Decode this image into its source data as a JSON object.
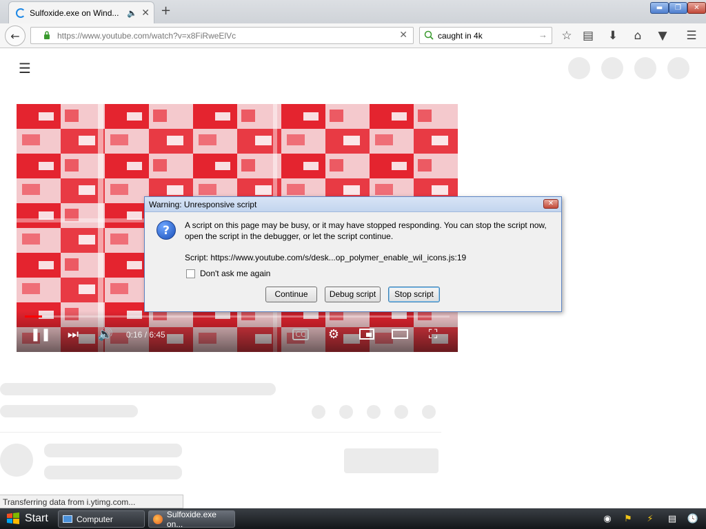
{
  "browser": {
    "tab_title": "Sulfoxide.exe on Wind...",
    "url": "https://www.youtube.com/watch?v=x8FiRweElVc",
    "search_text": "caught in 4k"
  },
  "video": {
    "time": "0:16 / 6:45",
    "progress_fraction": 0.04
  },
  "dialog": {
    "title": "Warning: Unresponsive script",
    "message": "A script on this page may be busy, or it may have stopped responding. You can stop the script now, open the script in the debugger, or let the script continue.",
    "script": "Script: https://www.youtube.com/s/desk...op_polymer_enable_wil_icons.js:19",
    "checkbox_label": "Don't ask me again",
    "buttons": {
      "continue": "Continue",
      "debug": "Debug script",
      "stop": "Stop script"
    }
  },
  "status_bar": "Transferring data from i.ytimg.com...",
  "taskbar": {
    "start": "Start",
    "items": [
      "Computer",
      "Sulfoxide.exe on..."
    ]
  }
}
